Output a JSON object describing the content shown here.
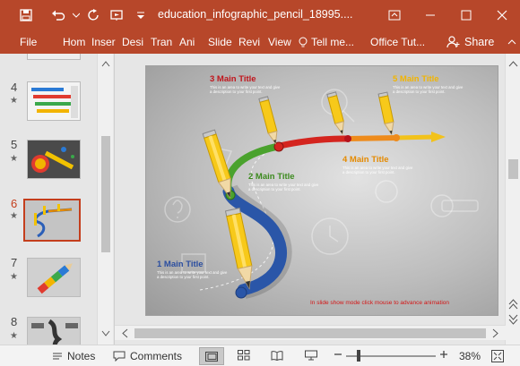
{
  "titlebar": {
    "file_name": "education_infographic_pencil_18995....",
    "qat": [
      "save-icon",
      "undo-icon",
      "redo-icon",
      "present-icon",
      "customize-icon"
    ]
  },
  "ribbon": {
    "tabs": [
      "File",
      "Hom",
      "Inser",
      "Desi",
      "Tran",
      "Ani",
      "Slide",
      "Revi",
      "View"
    ],
    "tell_me": "Tell me...",
    "office_tut": "Office Tut...",
    "share": "Share"
  },
  "thumbnails": [
    {
      "num": "4"
    },
    {
      "num": "5"
    },
    {
      "num": "6",
      "active": true
    },
    {
      "num": "7"
    },
    {
      "num": "8"
    }
  ],
  "slide": {
    "t1": "1 Main Title",
    "t2": "2 Main Title",
    "t3": "3 Main Title",
    "t4": "4 Main Title",
    "t5": "5 Main Title",
    "body": "This is an area to write your text and give a description to your first point.",
    "note": "In slide show mode click mouse to advance animation",
    "colors": {
      "t1": "#2b4ea0",
      "t2": "#3c8a1e",
      "t3": "#c0151c",
      "t4": "#e58a00",
      "t5": "#f2b400",
      "accent": "#b7472a"
    }
  },
  "statusbar": {
    "notes": "Notes",
    "comments": "Comments",
    "zoom": "38%"
  }
}
